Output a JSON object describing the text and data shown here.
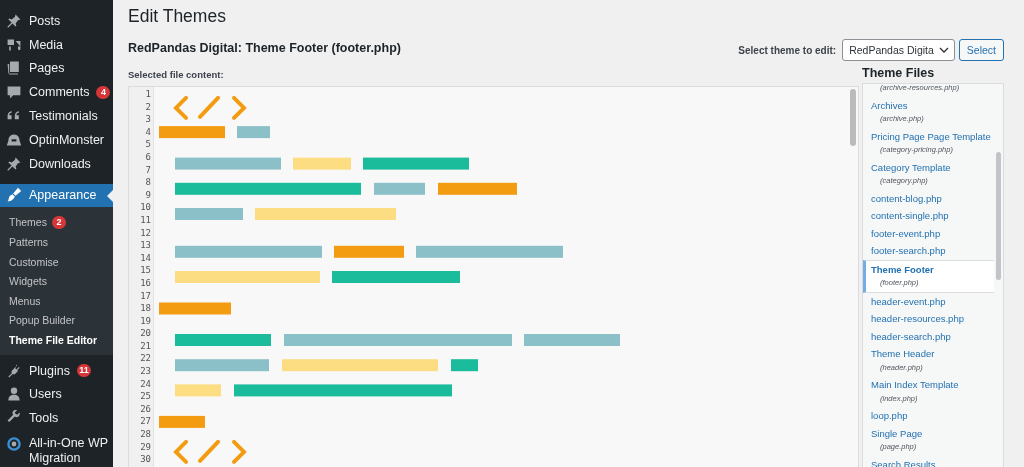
{
  "sidebar": {
    "items": [
      {
        "label": "Posts",
        "selected": false
      },
      {
        "label": "Media",
        "selected": false
      },
      {
        "label": "Pages",
        "selected": false
      },
      {
        "label": "Comments",
        "badge": "4",
        "selected": false
      },
      {
        "label": "Testimonials",
        "selected": false
      },
      {
        "label": "OptinMonster",
        "selected": false
      },
      {
        "label": "Downloads",
        "selected": false
      },
      {
        "label": "Appearance",
        "selected": true,
        "children": [
          {
            "label": "Themes",
            "badge": "2",
            "selected": false
          },
          {
            "label": "Patterns",
            "selected": false
          },
          {
            "label": "Customise",
            "selected": false
          },
          {
            "label": "Widgets",
            "selected": false
          },
          {
            "label": "Menus",
            "selected": false
          },
          {
            "label": "Popup Builder",
            "selected": false
          },
          {
            "label": "Theme File Editor",
            "selected": true
          }
        ]
      },
      {
        "label": "Plugins",
        "badge": "11",
        "selected": false
      },
      {
        "label": "Users",
        "selected": false
      },
      {
        "label": "Tools",
        "selected": false
      },
      {
        "label": "All-in-One WP Migration",
        "selected": false
      }
    ]
  },
  "page": {
    "title": "Edit Themes",
    "subtitle": "RedPandas Digital: Theme Footer (footer.php)",
    "theme_select": {
      "label": "Select theme to edit:",
      "value": "RedPandas Digita",
      "button": "Select"
    },
    "content_label": "Selected file content:"
  },
  "editor": {
    "line_numbers": [
      "1",
      "2",
      "3",
      "4",
      "5",
      "6",
      "7",
      "8",
      "9",
      "10",
      "11",
      "12",
      "13",
      "14",
      "15",
      "16",
      "17",
      "18",
      "19",
      "20",
      "21",
      "22",
      "23",
      "24",
      "25",
      "26",
      "27",
      "28",
      "29",
      "30"
    ]
  },
  "theme_files": {
    "heading": "Theme Files",
    "files": [
      {
        "file": "(archive-resources.php)",
        "selected": false
      },
      {
        "title": "Archives",
        "file": "(archive.php)",
        "selected": false
      },
      {
        "title": "Pricing Page Page Template",
        "file": "(category-pricing.php)",
        "selected": false
      },
      {
        "title": "Category Template",
        "file": "(category.php)",
        "selected": false
      },
      {
        "title": "content-blog.php",
        "selected": false
      },
      {
        "title": "content-single.php",
        "selected": false
      },
      {
        "title": "footer-event.php",
        "selected": false
      },
      {
        "title": "footer-search.php",
        "selected": false
      },
      {
        "title": "Theme Footer",
        "file": "(footer.php)",
        "selected": true
      },
      {
        "title": "header-event.php",
        "selected": false
      },
      {
        "title": "header-resources.php",
        "selected": false
      },
      {
        "title": "header-search.php",
        "selected": false
      },
      {
        "title": "Theme Header",
        "file": "(header.php)",
        "selected": false
      },
      {
        "title": "Main Index Template",
        "file": "(index.php)",
        "selected": false
      },
      {
        "title": "loop.php",
        "selected": false
      },
      {
        "title": "Single Page",
        "file": "(page.php)",
        "selected": false
      },
      {
        "title": "Search Results",
        "selected": false
      }
    ]
  }
}
